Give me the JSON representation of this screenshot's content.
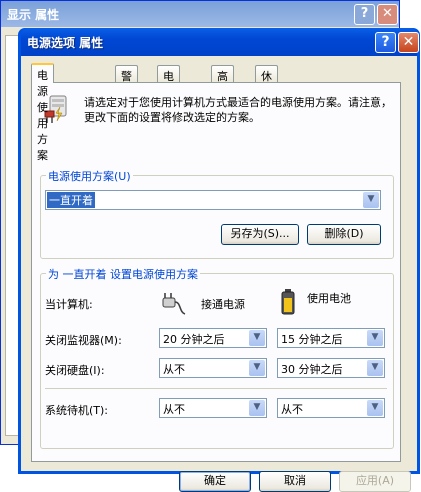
{
  "back_window": {
    "title": "显示 属性",
    "help": "?",
    "close": "✕"
  },
  "dialog": {
    "title": "电源选项 属性",
    "help": "?",
    "close": "✕"
  },
  "tabs": [
    {
      "label": "电源使用方案"
    },
    {
      "label": "警报"
    },
    {
      "label": "电表"
    },
    {
      "label": "高级"
    },
    {
      "label": "休眠"
    }
  ],
  "intro": {
    "text": "请选定对于您使用计算机方式最适合的电源使用方案。请注意，更改下面的设置将修改选定的方案。",
    "icon": "power-scheme-icon"
  },
  "scheme_group": {
    "label": "电源使用方案(U)",
    "selected": "一直开着",
    "save_as_button": "另存为(S)...",
    "delete_button": "删除(D)"
  },
  "settings_group": {
    "label": "为 一直开着 设置电源使用方案",
    "when_computer": "当计算机:",
    "plugged_in": "接通电源",
    "on_batteries": "使用电池",
    "rows": [
      {
        "label": "关闭监视器(M):",
        "plugged": "20 分钟之后",
        "battery": "15 分钟之后"
      },
      {
        "label": "关闭硬盘(I):",
        "plugged": "从不",
        "battery": "30 分钟之后"
      },
      {
        "label": "系统待机(T):",
        "plugged": "从不",
        "battery": "从不"
      }
    ]
  },
  "buttons": {
    "ok": "确定",
    "cancel": "取消",
    "apply": "应用(A)"
  },
  "colors": {
    "titlebar": "#0054e3",
    "tab_highlight": "#ffc83c",
    "group_label": "#0046d5"
  }
}
